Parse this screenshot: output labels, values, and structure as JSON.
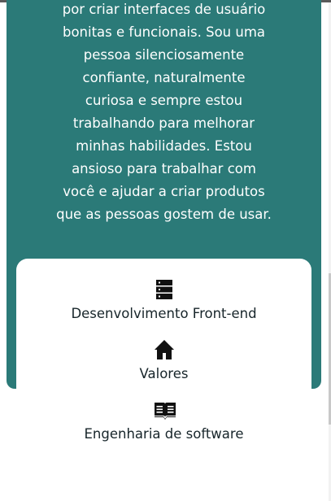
{
  "about": {
    "bio_lines": [
      "por criar interfaces de usuário",
      "bonitas e funcionais. Sou uma",
      "pessoa silenciosamente",
      "confiante, naturalmente",
      "curiosa e sempre estou",
      "trabalhando para melhorar",
      "minhas habilidades. Estou",
      "ansioso para trabalhar com",
      "você e ajudar a criar produtos",
      "que as pessoas gostem de usar."
    ]
  },
  "skills": [
    {
      "icon": "server-icon",
      "label": "Desenvolvimento Front-end"
    },
    {
      "icon": "home-icon",
      "label": "Valores"
    },
    {
      "icon": "book-open-icon",
      "label": "Engenharia de software"
    }
  ],
  "colors": {
    "hero_background": "#2b7a78",
    "card_background": "#ffffff",
    "text_dark": "#17252a",
    "text_light": "#ffffff"
  }
}
